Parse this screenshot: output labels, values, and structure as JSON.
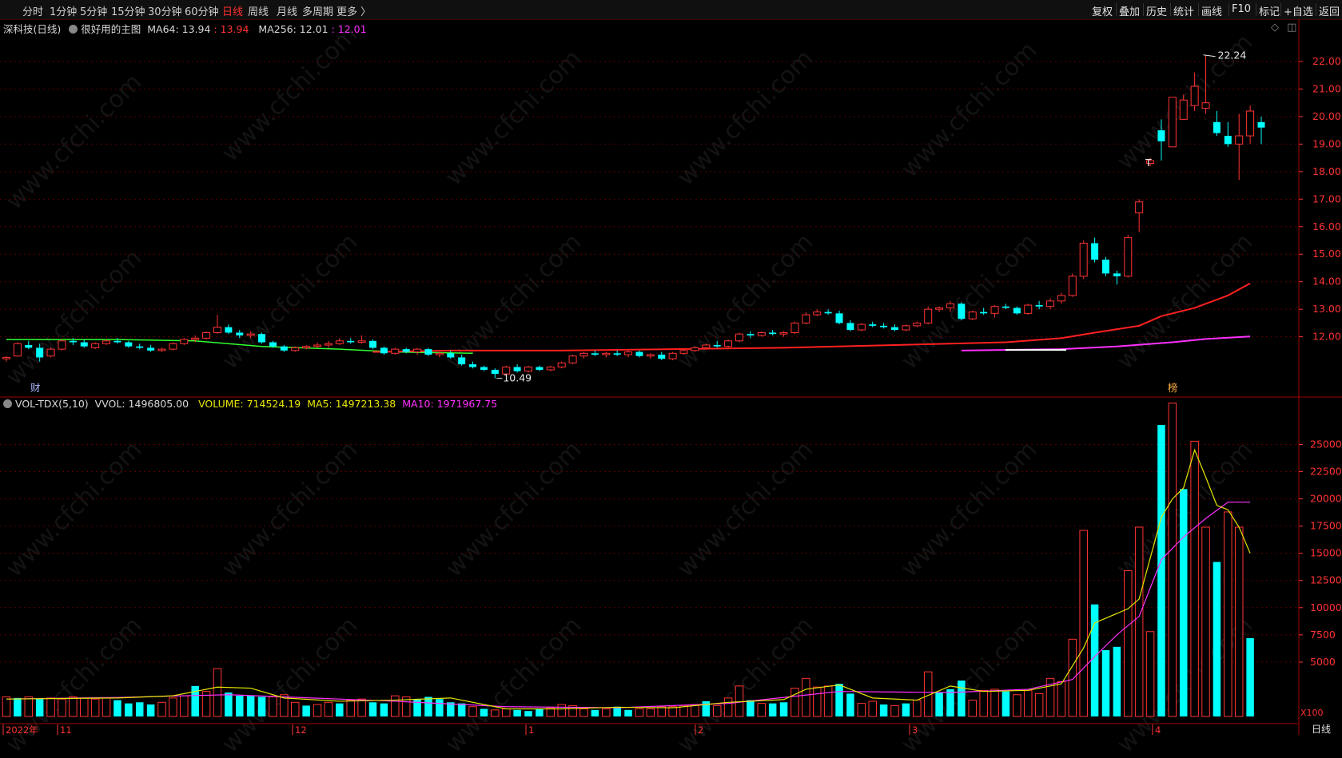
{
  "toolbar": {
    "left": [
      {
        "label": "分时",
        "active": false
      },
      {
        "label": "1分钟",
        "active": false
      },
      {
        "label": "5分钟",
        "active": false
      },
      {
        "label": "15分钟",
        "active": false
      },
      {
        "label": "30分钟",
        "active": false
      },
      {
        "label": "60分钟",
        "active": false
      },
      {
        "label": "日线",
        "active": true
      },
      {
        "label": "周线",
        "active": false
      },
      {
        "label": "月线",
        "active": false
      },
      {
        "label": "多周期",
        "active": false
      },
      {
        "label": "更多 〉",
        "active": false
      }
    ],
    "right": [
      "复权",
      "叠加",
      "历史",
      "统计",
      "画线",
      "F10",
      "标记",
      "+自选",
      "返回"
    ]
  },
  "main_info": {
    "stock": "深科技(日线)",
    "indicator": "很好用的主图",
    "ma64_label": "MA64: 13.94",
    "ma64_value": ": 13.94",
    "ma256_label": "MA256: 12.01",
    "ma256_value": ": 12.01"
  },
  "vol_info": {
    "name": "VOL-TDX(5,10)",
    "vvol": "VVOL: 1496805.00",
    "volume": "VOLUME: 714524.19",
    "ma5": "MA5: 1497213.38",
    "ma10": "MA10: 1971967.75"
  },
  "annotations": {
    "high": "22.24",
    "low": "10.49",
    "cai_marker": "财",
    "bang_marker": "榜",
    "t_marker": "T",
    "unit": "X100",
    "period": "日线"
  },
  "watermark": "www.cfchi.com",
  "colors": {
    "up": "#ff3333",
    "down": "#00ffff",
    "ma_red": "#ff2020",
    "ma_green": "#30ff30",
    "ma_magenta": "#ff30ff",
    "vol_ma5": "#e6e600",
    "vol_ma10": "#ff30ff"
  },
  "chart_data": {
    "type": "candlestick",
    "price_axis": {
      "ticks": [
        12,
        13,
        14,
        15,
        16,
        17,
        18,
        19,
        20,
        21,
        22
      ],
      "min": 9.9,
      "max": 22.9
    },
    "volume_axis": {
      "ticks": [
        5000,
        7500,
        10000,
        12500,
        15000,
        17500,
        20000,
        22500,
        25000
      ],
      "max": 29000
    },
    "x_labels": [
      "2022年",
      "11",
      "12",
      "1",
      "2",
      "3",
      "4"
    ],
    "candles": [
      [
        11.2,
        11.3,
        11.1,
        11.25
      ],
      [
        11.3,
        11.8,
        11.3,
        11.75
      ],
      [
        11.7,
        11.85,
        11.55,
        11.6
      ],
      [
        11.6,
        11.75,
        11.1,
        11.25
      ],
      [
        11.3,
        11.6,
        11.25,
        11.55
      ],
      [
        11.55,
        11.9,
        11.5,
        11.85
      ],
      [
        11.85,
        11.95,
        11.7,
        11.8
      ],
      [
        11.8,
        11.9,
        11.6,
        11.65
      ],
      [
        11.6,
        11.8,
        11.55,
        11.75
      ],
      [
        11.75,
        11.9,
        11.7,
        11.85
      ],
      [
        11.85,
        11.95,
        11.75,
        11.8
      ],
      [
        11.8,
        11.85,
        11.6,
        11.65
      ],
      [
        11.65,
        11.75,
        11.55,
        11.6
      ],
      [
        11.6,
        11.7,
        11.45,
        11.5
      ],
      [
        11.5,
        11.6,
        11.45,
        11.55
      ],
      [
        11.55,
        11.8,
        11.5,
        11.75
      ],
      [
        11.75,
        11.95,
        11.7,
        11.9
      ],
      [
        11.9,
        12.05,
        11.8,
        11.95
      ],
      [
        11.95,
        12.2,
        11.9,
        12.15
      ],
      [
        12.15,
        12.8,
        12.1,
        12.35
      ],
      [
        12.35,
        12.45,
        12.1,
        12.15
      ],
      [
        12.15,
        12.25,
        11.95,
        12.05
      ],
      [
        12.05,
        12.2,
        11.95,
        12.1
      ],
      [
        12.1,
        12.15,
        11.75,
        11.8
      ],
      [
        11.8,
        11.85,
        11.6,
        11.65
      ],
      [
        11.65,
        11.7,
        11.45,
        11.5
      ],
      [
        11.5,
        11.65,
        11.45,
        11.6
      ],
      [
        11.6,
        11.7,
        11.55,
        11.65
      ],
      [
        11.65,
        11.8,
        11.6,
        11.7
      ],
      [
        11.7,
        11.85,
        11.6,
        11.75
      ],
      [
        11.75,
        11.95,
        11.7,
        11.85
      ],
      [
        11.85,
        11.95,
        11.75,
        11.8
      ],
      [
        11.8,
        12.05,
        11.75,
        11.85
      ],
      [
        11.85,
        11.9,
        11.55,
        11.6
      ],
      [
        11.6,
        11.65,
        11.35,
        11.4
      ],
      [
        11.4,
        11.6,
        11.35,
        11.55
      ],
      [
        11.55,
        11.6,
        11.4,
        11.45
      ],
      [
        11.45,
        11.6,
        11.35,
        11.55
      ],
      [
        11.55,
        11.6,
        11.3,
        11.35
      ],
      [
        11.35,
        11.45,
        11.25,
        11.4
      ],
      [
        11.4,
        11.5,
        11.2,
        11.25
      ],
      [
        11.25,
        11.35,
        10.95,
        11.0
      ],
      [
        11.0,
        11.1,
        10.85,
        10.9
      ],
      [
        10.9,
        10.95,
        10.75,
        10.8
      ],
      [
        10.8,
        10.85,
        10.49,
        10.65
      ],
      [
        10.65,
        10.95,
        10.6,
        10.9
      ],
      [
        10.9,
        11.0,
        10.7,
        10.75
      ],
      [
        10.75,
        10.95,
        10.7,
        10.9
      ],
      [
        10.9,
        10.95,
        10.75,
        10.8
      ],
      [
        10.8,
        10.95,
        10.75,
        10.9
      ],
      [
        10.9,
        11.1,
        10.85,
        11.05
      ],
      [
        11.05,
        11.35,
        11.0,
        11.3
      ],
      [
        11.3,
        11.45,
        11.2,
        11.4
      ],
      [
        11.4,
        11.5,
        11.3,
        11.35
      ],
      [
        11.35,
        11.45,
        11.25,
        11.4
      ],
      [
        11.4,
        11.5,
        11.3,
        11.35
      ],
      [
        11.35,
        11.5,
        11.25,
        11.45
      ],
      [
        11.45,
        11.5,
        11.25,
        11.3
      ],
      [
        11.3,
        11.4,
        11.2,
        11.35
      ],
      [
        11.35,
        11.45,
        11.15,
        11.2
      ],
      [
        11.2,
        11.45,
        11.15,
        11.4
      ],
      [
        11.4,
        11.55,
        11.35,
        11.5
      ],
      [
        11.5,
        11.65,
        11.45,
        11.6
      ],
      [
        11.6,
        11.75,
        11.55,
        11.7
      ],
      [
        11.7,
        11.85,
        11.6,
        11.65
      ],
      [
        11.65,
        11.9,
        11.6,
        11.85
      ],
      [
        11.85,
        12.15,
        11.8,
        12.1
      ],
      [
        12.1,
        12.2,
        11.95,
        12.05
      ],
      [
        12.05,
        12.2,
        12.0,
        12.15
      ],
      [
        12.15,
        12.25,
        12.05,
        12.1
      ],
      [
        12.1,
        12.2,
        12.0,
        12.15
      ],
      [
        12.15,
        12.55,
        12.1,
        12.5
      ],
      [
        12.5,
        12.9,
        12.45,
        12.8
      ],
      [
        12.8,
        13.0,
        12.75,
        12.9
      ],
      [
        12.9,
        13.0,
        12.8,
        12.85
      ],
      [
        12.85,
        12.95,
        12.45,
        12.5
      ],
      [
        12.5,
        12.6,
        12.2,
        12.25
      ],
      [
        12.25,
        12.5,
        12.2,
        12.45
      ],
      [
        12.45,
        12.55,
        12.35,
        12.4
      ],
      [
        12.4,
        12.5,
        12.3,
        12.35
      ],
      [
        12.35,
        12.45,
        12.2,
        12.25
      ],
      [
        12.25,
        12.45,
        12.2,
        12.4
      ],
      [
        12.4,
        12.55,
        12.35,
        12.5
      ],
      [
        12.5,
        13.1,
        12.45,
        13.0
      ],
      [
        13.0,
        13.1,
        12.9,
        13.05
      ],
      [
        13.05,
        13.3,
        12.9,
        13.2
      ],
      [
        13.2,
        13.25,
        12.6,
        12.65
      ],
      [
        12.65,
        12.95,
        12.6,
        12.9
      ],
      [
        12.9,
        13.05,
        12.8,
        12.85
      ],
      [
        12.85,
        13.15,
        12.7,
        13.1
      ],
      [
        13.1,
        13.2,
        13.0,
        13.05
      ],
      [
        13.05,
        13.1,
        12.8,
        12.85
      ],
      [
        12.85,
        13.2,
        12.8,
        13.15
      ],
      [
        13.15,
        13.3,
        13.0,
        13.1
      ],
      [
        13.1,
        13.4,
        13.0,
        13.3
      ],
      [
        13.3,
        13.6,
        13.2,
        13.5
      ],
      [
        13.5,
        14.3,
        13.45,
        14.2
      ],
      [
        14.2,
        15.5,
        14.1,
        15.4
      ],
      [
        15.4,
        15.6,
        14.7,
        14.8
      ],
      [
        14.8,
        14.9,
        14.2,
        14.3
      ],
      [
        14.3,
        14.4,
        13.9,
        14.2
      ],
      [
        14.2,
        15.7,
        14.15,
        15.6
      ],
      [
        16.5,
        17.0,
        15.8,
        16.9
      ],
      [
        18.3,
        18.5,
        18.2,
        18.4
      ],
      [
        19.5,
        19.9,
        18.4,
        19.1
      ],
      [
        18.9,
        20.7,
        18.9,
        20.7
      ],
      [
        19.9,
        20.8,
        19.9,
        20.6
      ],
      [
        20.4,
        21.6,
        20.2,
        21.1
      ],
      [
        20.3,
        22.24,
        20.1,
        20.5
      ],
      [
        19.8,
        20.2,
        19.3,
        19.4
      ],
      [
        19.3,
        19.8,
        18.9,
        19.0
      ],
      [
        19.0,
        20.1,
        17.7,
        19.3
      ],
      [
        19.3,
        20.4,
        19.0,
        20.2
      ],
      [
        19.8,
        20.0,
        19.0,
        19.6
      ]
    ],
    "volumes": [
      [
        1800,
        1
      ],
      [
        1700,
        0
      ],
      [
        1800,
        1
      ],
      [
        1600,
        0
      ],
      [
        1700,
        1
      ],
      [
        1600,
        1
      ],
      [
        1800,
        1
      ],
      [
        1700,
        1
      ],
      [
        1600,
        1
      ],
      [
        1700,
        1
      ],
      [
        1500,
        0
      ],
      [
        1200,
        0
      ],
      [
        1300,
        0
      ],
      [
        1100,
        0
      ],
      [
        1300,
        1
      ],
      [
        1700,
        1
      ],
      [
        1900,
        1
      ],
      [
        2800,
        0
      ],
      [
        2300,
        1
      ],
      [
        4400,
        1
      ],
      [
        2200,
        0
      ],
      [
        1900,
        0
      ],
      [
        1900,
        0
      ],
      [
        1800,
        0
      ],
      [
        1800,
        1
      ],
      [
        2000,
        1
      ],
      [
        1300,
        1
      ],
      [
        1000,
        0
      ],
      [
        1100,
        1
      ],
      [
        1300,
        1
      ],
      [
        1200,
        0
      ],
      [
        1500,
        1
      ],
      [
        1600,
        1
      ],
      [
        1300,
        0
      ],
      [
        1200,
        0
      ],
      [
        1900,
        1
      ],
      [
        1800,
        1
      ],
      [
        1600,
        0
      ],
      [
        1800,
        0
      ],
      [
        1600,
        0
      ],
      [
        1300,
        0
      ],
      [
        1200,
        0
      ],
      [
        900,
        1
      ],
      [
        700,
        0
      ],
      [
        600,
        1
      ],
      [
        700,
        1
      ],
      [
        600,
        0
      ],
      [
        500,
        0
      ],
      [
        700,
        0
      ],
      [
        800,
        1
      ],
      [
        1100,
        1
      ],
      [
        1000,
        1
      ],
      [
        700,
        1
      ],
      [
        600,
        0
      ],
      [
        700,
        1
      ],
      [
        900,
        0
      ],
      [
        600,
        0
      ],
      [
        700,
        1
      ],
      [
        700,
        1
      ],
      [
        900,
        1
      ],
      [
        900,
        1
      ],
      [
        1000,
        1
      ],
      [
        1100,
        1
      ],
      [
        1400,
        0
      ],
      [
        1000,
        1
      ],
      [
        1700,
        1
      ],
      [
        2800,
        1
      ],
      [
        1500,
        0
      ],
      [
        1200,
        1
      ],
      [
        1200,
        0
      ],
      [
        1300,
        0
      ],
      [
        2600,
        1
      ],
      [
        3500,
        1
      ],
      [
        2700,
        1
      ],
      [
        2800,
        1
      ],
      [
        3000,
        0
      ],
      [
        2100,
        0
      ],
      [
        1200,
        1
      ],
      [
        1400,
        1
      ],
      [
        1100,
        0
      ],
      [
        1000,
        1
      ],
      [
        1200,
        0
      ],
      [
        1500,
        1
      ],
      [
        4100,
        1
      ],
      [
        2200,
        0
      ],
      [
        2500,
        0
      ],
      [
        3300,
        0
      ],
      [
        1500,
        1
      ],
      [
        2400,
        1
      ],
      [
        2500,
        1
      ],
      [
        2300,
        0
      ],
      [
        2000,
        1
      ],
      [
        2400,
        1
      ],
      [
        2100,
        1
      ],
      [
        3500,
        1
      ],
      [
        3200,
        1
      ],
      [
        7100,
        1
      ],
      [
        17100,
        1
      ],
      [
        10300,
        0
      ],
      [
        6100,
        0
      ],
      [
        6400,
        0
      ],
      [
        13400,
        1
      ],
      [
        17400,
        1
      ],
      [
        7800,
        1
      ],
      [
        26800,
        0
      ],
      [
        28800,
        1
      ],
      [
        20900,
        0
      ],
      [
        25300,
        1
      ],
      [
        17400,
        1
      ],
      [
        14200,
        0
      ],
      [
        18800,
        1
      ],
      [
        17400,
        1
      ],
      [
        7200,
        0
      ]
    ],
    "ma_red": [
      [
        33,
        11.45
      ],
      [
        40,
        11.5
      ],
      [
        50,
        11.5
      ],
      [
        60,
        11.55
      ],
      [
        70,
        11.6
      ],
      [
        80,
        11.7
      ],
      [
        90,
        11.8
      ],
      [
        95,
        11.95
      ],
      [
        98,
        12.15
      ],
      [
        102,
        12.4
      ],
      [
        104,
        12.75
      ],
      [
        107,
        13.05
      ],
      [
        110,
        13.5
      ],
      [
        112,
        13.94
      ]
    ],
    "ma_green": [
      [
        0,
        11.9
      ],
      [
        10,
        11.9
      ],
      [
        17,
        11.85
      ],
      [
        23,
        11.65
      ],
      [
        30,
        11.55
      ],
      [
        35,
        11.45
      ],
      [
        42,
        11.4
      ]
    ],
    "ma_magenta": [
      [
        86,
        11.5
      ],
      [
        95,
        11.55
      ],
      [
        100,
        11.65
      ],
      [
        105,
        11.8
      ],
      [
        108,
        11.92
      ],
      [
        112,
        12.01
      ]
    ],
    "vol_ma5": [
      [
        0,
        1600
      ],
      [
        5,
        1650
      ],
      [
        10,
        1700
      ],
      [
        15,
        1900
      ],
      [
        19,
        2700
      ],
      [
        22,
        2600
      ],
      [
        25,
        1700
      ],
      [
        30,
        1400
      ],
      [
        35,
        1500
      ],
      [
        40,
        1700
      ],
      [
        45,
        700
      ],
      [
        50,
        700
      ],
      [
        55,
        850
      ],
      [
        60,
        800
      ],
      [
        65,
        1300
      ],
      [
        70,
        1550
      ],
      [
        72,
        2500
      ],
      [
        75,
        2900
      ],
      [
        78,
        1700
      ],
      [
        82,
        1500
      ],
      [
        85,
        2800
      ],
      [
        88,
        2300
      ],
      [
        92,
        2400
      ],
      [
        95,
        3000
      ],
      [
        97,
        6300
      ],
      [
        98,
        8600
      ],
      [
        101,
        9900
      ],
      [
        102,
        10800
      ],
      [
        104,
        18300
      ],
      [
        105,
        20000
      ],
      [
        106,
        21000
      ],
      [
        107,
        24500
      ],
      [
        108,
        22000
      ],
      [
        109,
        19400
      ],
      [
        110,
        19000
      ],
      [
        111,
        17400
      ],
      [
        112,
        15000
      ]
    ],
    "vol_ma10": [
      [
        0,
        1600
      ],
      [
        10,
        1750
      ],
      [
        20,
        2000
      ],
      [
        25,
        1800
      ],
      [
        35,
        1400
      ],
      [
        45,
        900
      ],
      [
        55,
        800
      ],
      [
        65,
        1200
      ],
      [
        75,
        2300
      ],
      [
        85,
        2200
      ],
      [
        92,
        2500
      ],
      [
        96,
        3400
      ],
      [
        98,
        5500
      ],
      [
        100,
        7500
      ],
      [
        102,
        9200
      ],
      [
        104,
        14400
      ],
      [
        106,
        16500
      ],
      [
        108,
        18200
      ],
      [
        110,
        19700
      ],
      [
        112,
        19700
      ]
    ]
  }
}
